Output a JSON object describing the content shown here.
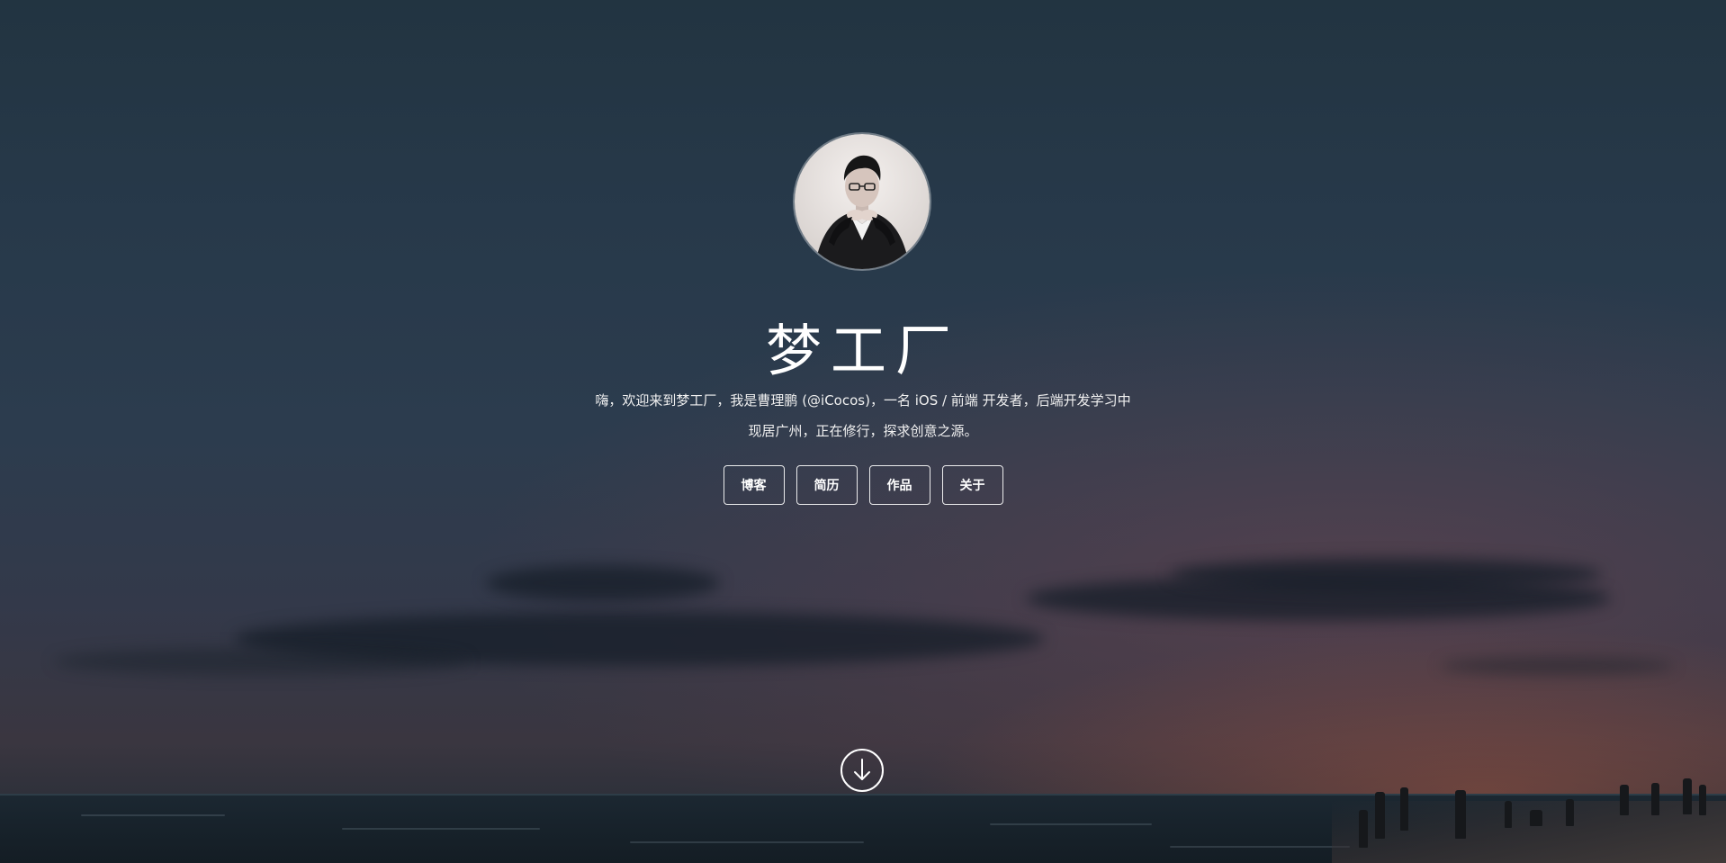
{
  "header": {
    "title": "梦工厂",
    "intro_line1": "嗨，欢迎来到梦工厂，我是曹理鹏 (@iCocos)，一名 iOS / 前端 开发者，后端开发学习中",
    "intro_line2": "现居广州，正在修行，探求创意之源。"
  },
  "nav": {
    "items": [
      {
        "label": "博客"
      },
      {
        "label": "简历"
      },
      {
        "label": "作品"
      },
      {
        "label": "关于"
      }
    ]
  },
  "icons": {
    "scroll": "arrow-down-circle-icon",
    "avatar": "avatar-photo"
  },
  "colors": {
    "text": "#ffffff",
    "sky_top": "#223441",
    "sky_sunset": "#8a5040"
  }
}
